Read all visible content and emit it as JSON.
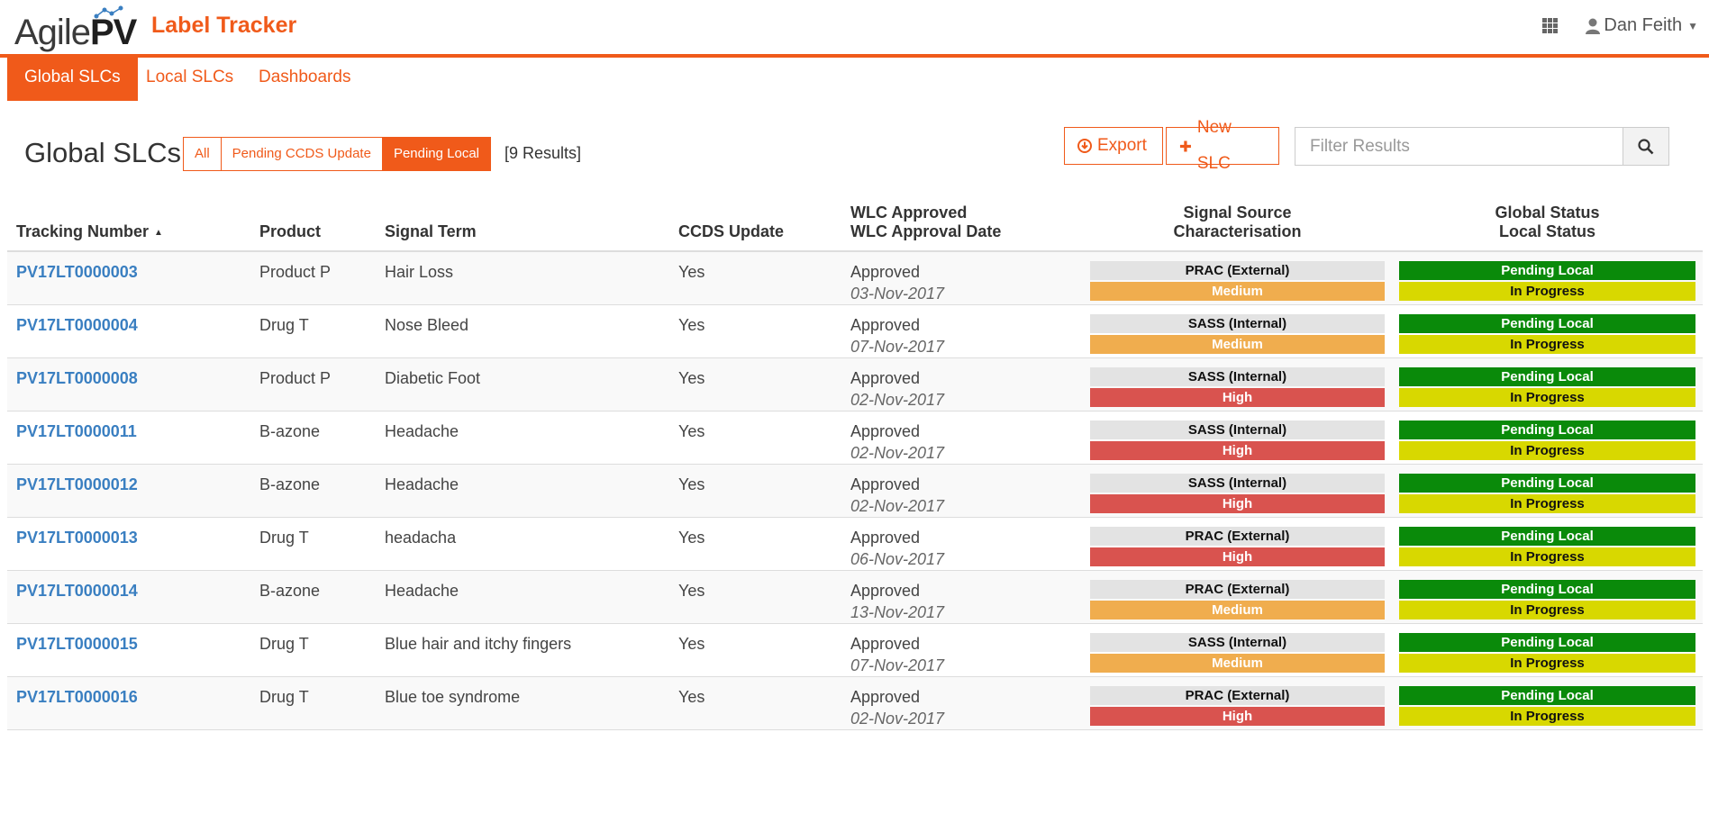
{
  "header": {
    "logo_text": "Agile",
    "logo_text_bold": "PV",
    "app_title": "Label Tracker",
    "user_name": "Dan Feith"
  },
  "nav": {
    "items": [
      {
        "label": "Global SLCs",
        "active": true
      },
      {
        "label": "Local SLCs",
        "active": false
      },
      {
        "label": "Dashboards",
        "active": false
      }
    ]
  },
  "toolbar": {
    "page_title": "Global SLCs",
    "filters": [
      {
        "label": "All",
        "active": false
      },
      {
        "label": "Pending CCDS Update",
        "active": false
      },
      {
        "label": "Pending Local",
        "active": true
      }
    ],
    "result_count": "[9 Results]",
    "export_label": "Export",
    "new_label": "New SLC",
    "search_placeholder": "Filter Results"
  },
  "table": {
    "headers": {
      "tracking": "Tracking Number",
      "product": "Product",
      "signal_term": "Signal Term",
      "ccds": "CCDS Update",
      "wlc_line1": "WLC Approved",
      "wlc_line2": "WLC Approval Date",
      "source_line1": "Signal Source",
      "source_line2": "Characterisation",
      "status_line1": "Global Status",
      "status_line2": "Local Status"
    },
    "rows": [
      {
        "tracking": "PV17LT0000003",
        "product": "Product P",
        "signal_term": "Hair Loss",
        "ccds": "Yes",
        "wlc": "Approved",
        "wlc_date": "03-Nov-2017",
        "source": "PRAC (External)",
        "characterisation": "Medium",
        "global_status": "Pending Local",
        "local_status": "In Progress"
      },
      {
        "tracking": "PV17LT0000004",
        "product": "Drug T",
        "signal_term": "Nose Bleed",
        "ccds": "Yes",
        "wlc": "Approved",
        "wlc_date": "07-Nov-2017",
        "source": "SASS (Internal)",
        "characterisation": "Medium",
        "global_status": "Pending Local",
        "local_status": "In Progress"
      },
      {
        "tracking": "PV17LT0000008",
        "product": "Product P",
        "signal_term": "Diabetic Foot",
        "ccds": "Yes",
        "wlc": "Approved",
        "wlc_date": "02-Nov-2017",
        "source": "SASS (Internal)",
        "characterisation": "High",
        "global_status": "Pending Local",
        "local_status": "In Progress"
      },
      {
        "tracking": "PV17LT0000011",
        "product": "B-azone",
        "signal_term": "Headache",
        "ccds": "Yes",
        "wlc": "Approved",
        "wlc_date": "02-Nov-2017",
        "source": "SASS (Internal)",
        "characterisation": "High",
        "global_status": "Pending Local",
        "local_status": "In Progress"
      },
      {
        "tracking": "PV17LT0000012",
        "product": "B-azone",
        "signal_term": "Headache",
        "ccds": "Yes",
        "wlc": "Approved",
        "wlc_date": "02-Nov-2017",
        "source": "SASS (Internal)",
        "characterisation": "High",
        "global_status": "Pending Local",
        "local_status": "In Progress"
      },
      {
        "tracking": "PV17LT0000013",
        "product": "Drug T",
        "signal_term": "headacha",
        "ccds": "Yes",
        "wlc": "Approved",
        "wlc_date": "06-Nov-2017",
        "source": "PRAC (External)",
        "characterisation": "High",
        "global_status": "Pending Local",
        "local_status": "In Progress"
      },
      {
        "tracking": "PV17LT0000014",
        "product": "B-azone",
        "signal_term": "Headache",
        "ccds": "Yes",
        "wlc": "Approved",
        "wlc_date": "13-Nov-2017",
        "source": "PRAC (External)",
        "characterisation": "Medium",
        "global_status": "Pending Local",
        "local_status": "In Progress"
      },
      {
        "tracking": "PV17LT0000015",
        "product": "Drug T",
        "signal_term": "Blue hair and itchy fingers",
        "ccds": "Yes",
        "wlc": "Approved",
        "wlc_date": "07-Nov-2017",
        "source": "SASS (Internal)",
        "characterisation": "Medium",
        "global_status": "Pending Local",
        "local_status": "In Progress"
      },
      {
        "tracking": "PV17LT0000016",
        "product": "Drug T",
        "signal_term": "Blue toe syndrome",
        "ccds": "Yes",
        "wlc": "Approved",
        "wlc_date": "02-Nov-2017",
        "source": "PRAC (External)",
        "characterisation": "High",
        "global_status": "Pending Local",
        "local_status": "In Progress"
      }
    ]
  },
  "colors": {
    "accent": "#f05a1a",
    "link": "#3a7fc1",
    "medium": "#f0ad4e",
    "high": "#d9534f",
    "global_status": "#0a8a0a",
    "local_status": "#d8d800",
    "source_badge": "#e3e3e3"
  },
  "icons": {
    "apps": "grid-icon",
    "user": "user-icon",
    "export": "download-circle-icon",
    "new": "plus-icon",
    "search": "search-icon"
  }
}
